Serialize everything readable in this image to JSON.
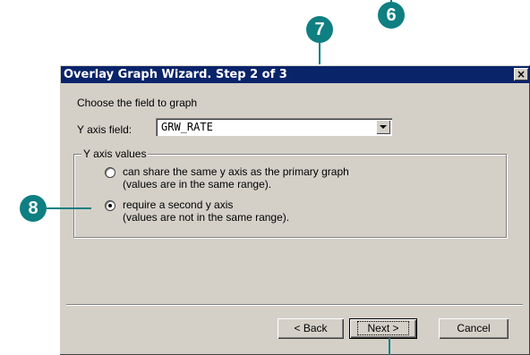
{
  "callouts": {
    "six": "6",
    "seven": "7",
    "eight": "8"
  },
  "dialog": {
    "title": "Overlay Graph Wizard. Step 2 of 3",
    "close_glyph": "×",
    "instruction": "Choose the field to graph",
    "y_axis_field_label": "Y axis field:",
    "y_axis_field_value": "GRW_RATE",
    "group_label": "Y axis values",
    "options": [
      {
        "line1": "can share the same y axis as the primary graph",
        "line2": "(values are in the same range).",
        "selected": false
      },
      {
        "line1": "require a second y axis",
        "line2": "(values are not in the same range).",
        "selected": true
      }
    ],
    "buttons": {
      "back": "< Back",
      "next": "Next >",
      "cancel": "Cancel"
    }
  },
  "colors": {
    "callout": "#0f7f82",
    "titlebar": "#0a246a",
    "dialog_face": "#d4d0c8"
  }
}
